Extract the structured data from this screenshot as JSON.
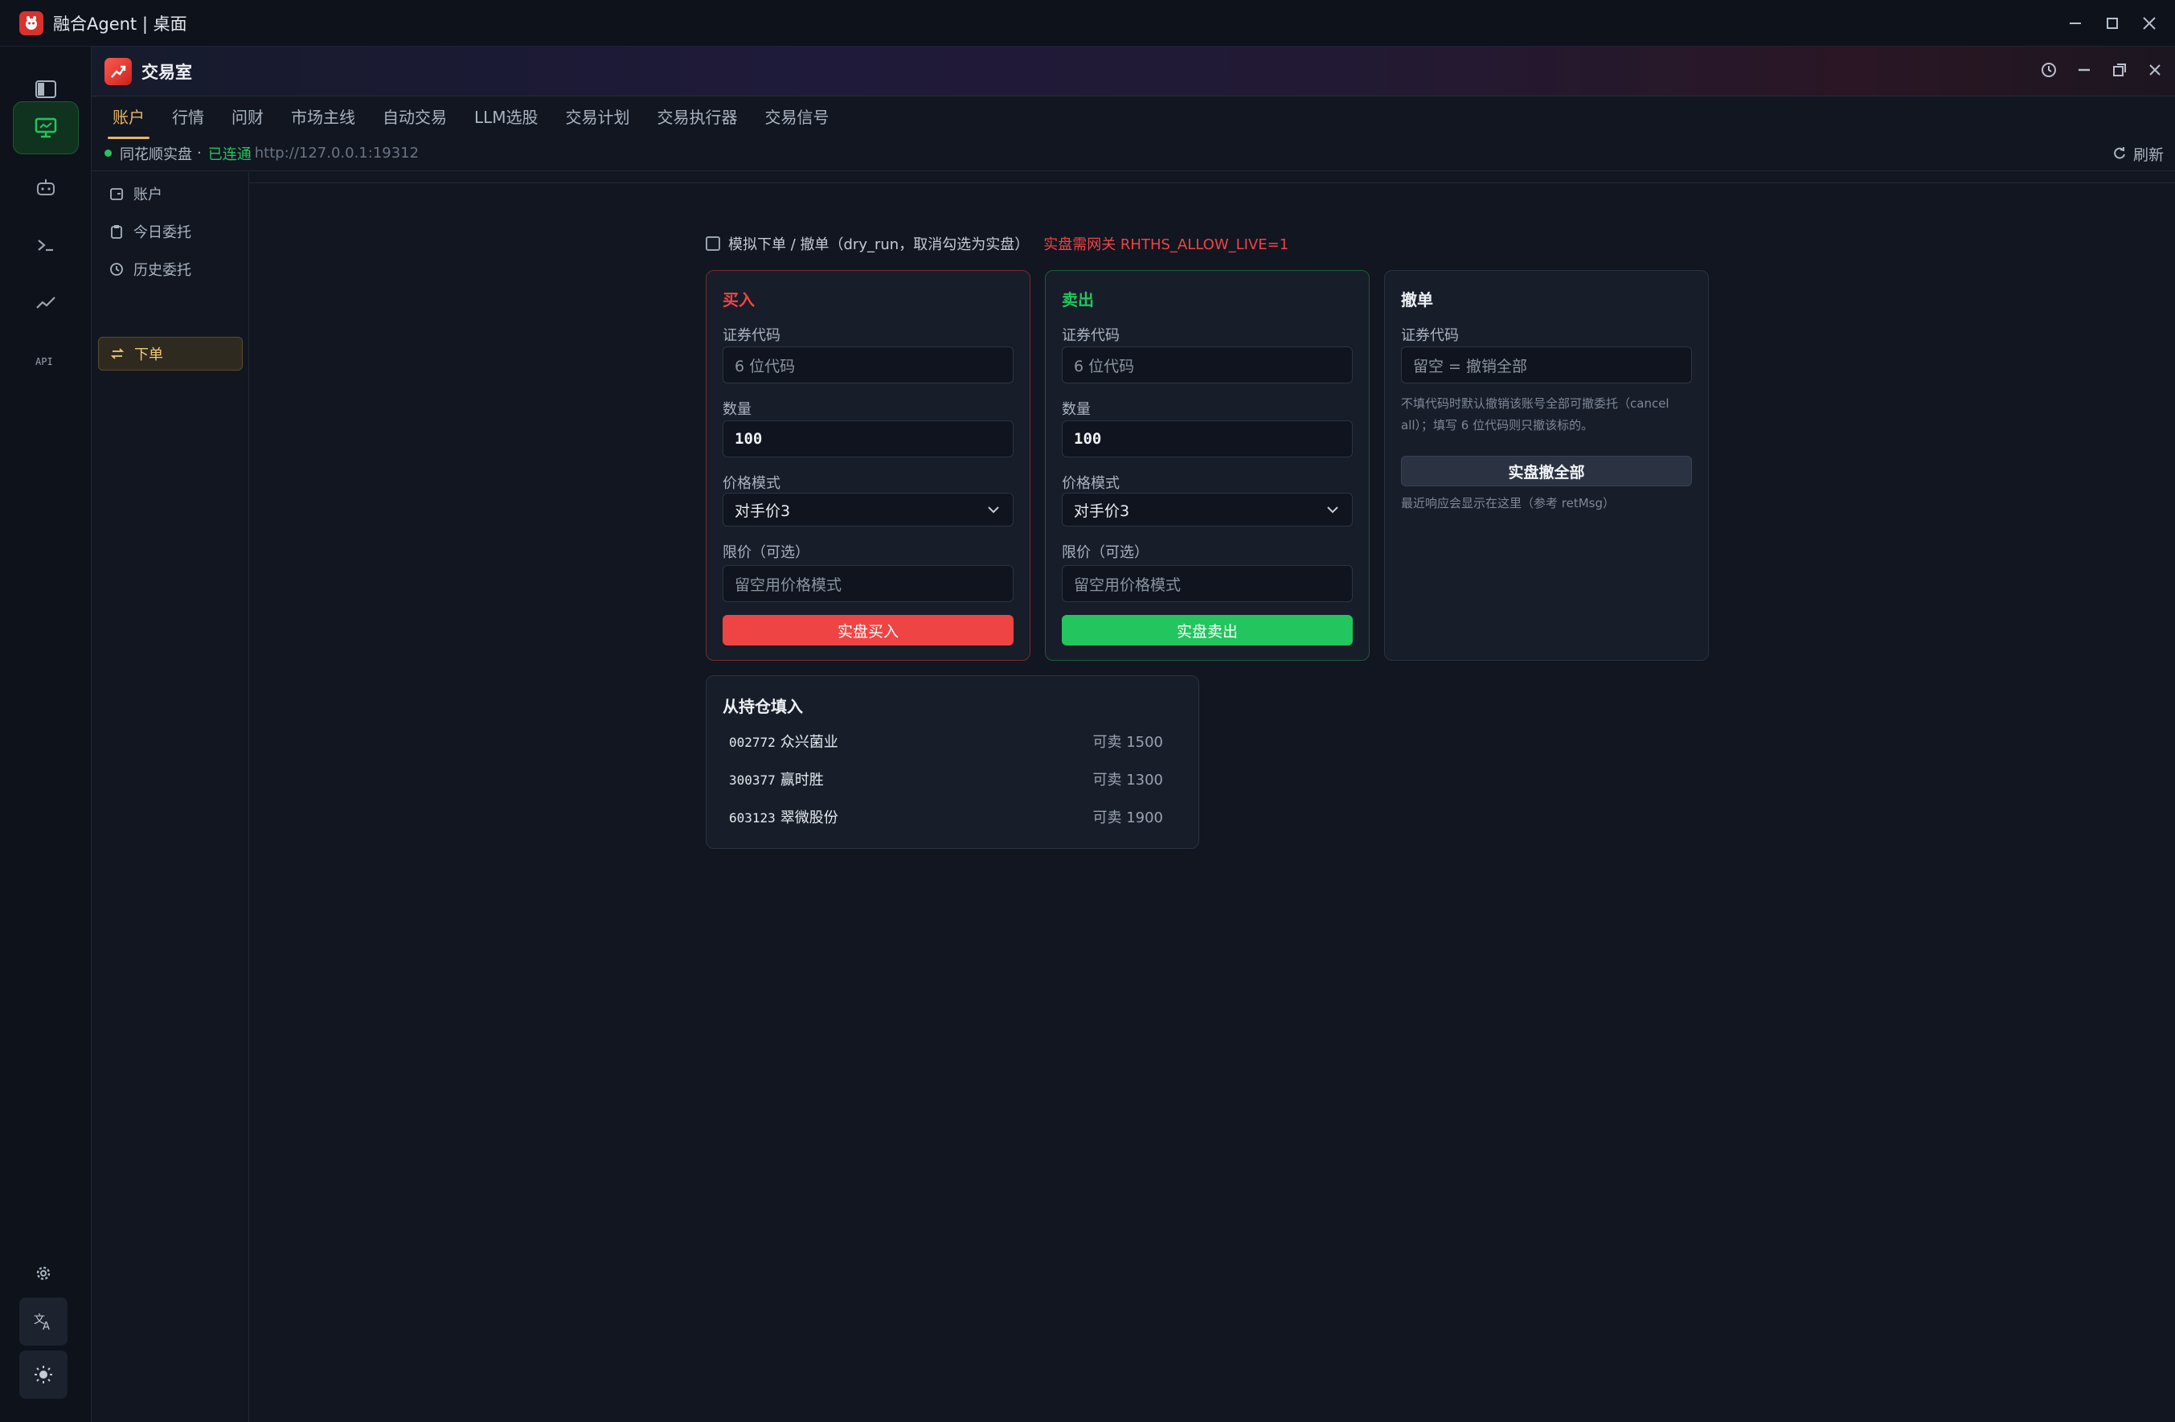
{
  "window": {
    "title": "融合Agent | 桌面"
  },
  "panel": {
    "title": "交易室"
  },
  "tabs": [
    "账户",
    "行情",
    "问财",
    "市场主线",
    "自动交易",
    "LLM选股",
    "交易计划",
    "交易执行器",
    "交易信号"
  ],
  "status": {
    "account": "同花顺实盘",
    "sep": "·",
    "connected": "已连通",
    "url": "http://127.0.0.1:19312",
    "refresh_label": "刷新"
  },
  "subnav": [
    {
      "label": "账户",
      "icon": "wallet-icon"
    },
    {
      "label": "今日委托",
      "icon": "clipboard-icon"
    },
    {
      "label": "历史委托",
      "icon": "history-icon"
    },
    {
      "label": "下单",
      "icon": "swap-icon"
    }
  ],
  "mode": {
    "checkbox_label": "模拟下单 / 撤单（dry_run，取消勾选为实盘）",
    "checked": false,
    "warning": "实盘需网关 RHTHS_ALLOW_LIVE=1"
  },
  "buy": {
    "title": "买入",
    "code_label": "证券代码",
    "code_placeholder": "6 位代码",
    "qty_label": "数量",
    "qty_value": "100",
    "price_mode_label": "价格模式",
    "price_mode_value": "对手价3",
    "limit_label": "限价（可选）",
    "limit_placeholder": "留空用价格模式",
    "submit_label": "实盘买入"
  },
  "sell": {
    "title": "卖出",
    "code_label": "证券代码",
    "code_placeholder": "6 位代码",
    "qty_label": "数量",
    "qty_value": "100",
    "price_mode_label": "价格模式",
    "price_mode_value": "对手价3",
    "limit_label": "限价（可选）",
    "limit_placeholder": "留空用价格模式",
    "submit_label": "实盘卖出"
  },
  "cancel": {
    "title": "撤单",
    "code_label": "证券代码",
    "code_placeholder": "留空 = 撤销全部",
    "hint": "不填代码时默认撤销该账号全部可撤委托（cancel all）；填写 6 位代码则只撤该标的。",
    "submit_label": "实盘撤全部",
    "response_hint": "最近响应会显示在这里（参考 retMsg）"
  },
  "holdings": {
    "title": "从持仓填入",
    "rows": [
      {
        "code": "002772",
        "name": "众兴菌业",
        "avail": "可卖 1500"
      },
      {
        "code": "300377",
        "name": "赢时胜",
        "avail": "可卖 1300"
      },
      {
        "code": "603123",
        "name": "翠微股份",
        "avail": "可卖 1900"
      }
    ]
  },
  "colors": {
    "accent": "#e6b565",
    "buy": "#ef4444",
    "sell": "#22c55e",
    "warn": "#ef4444"
  }
}
